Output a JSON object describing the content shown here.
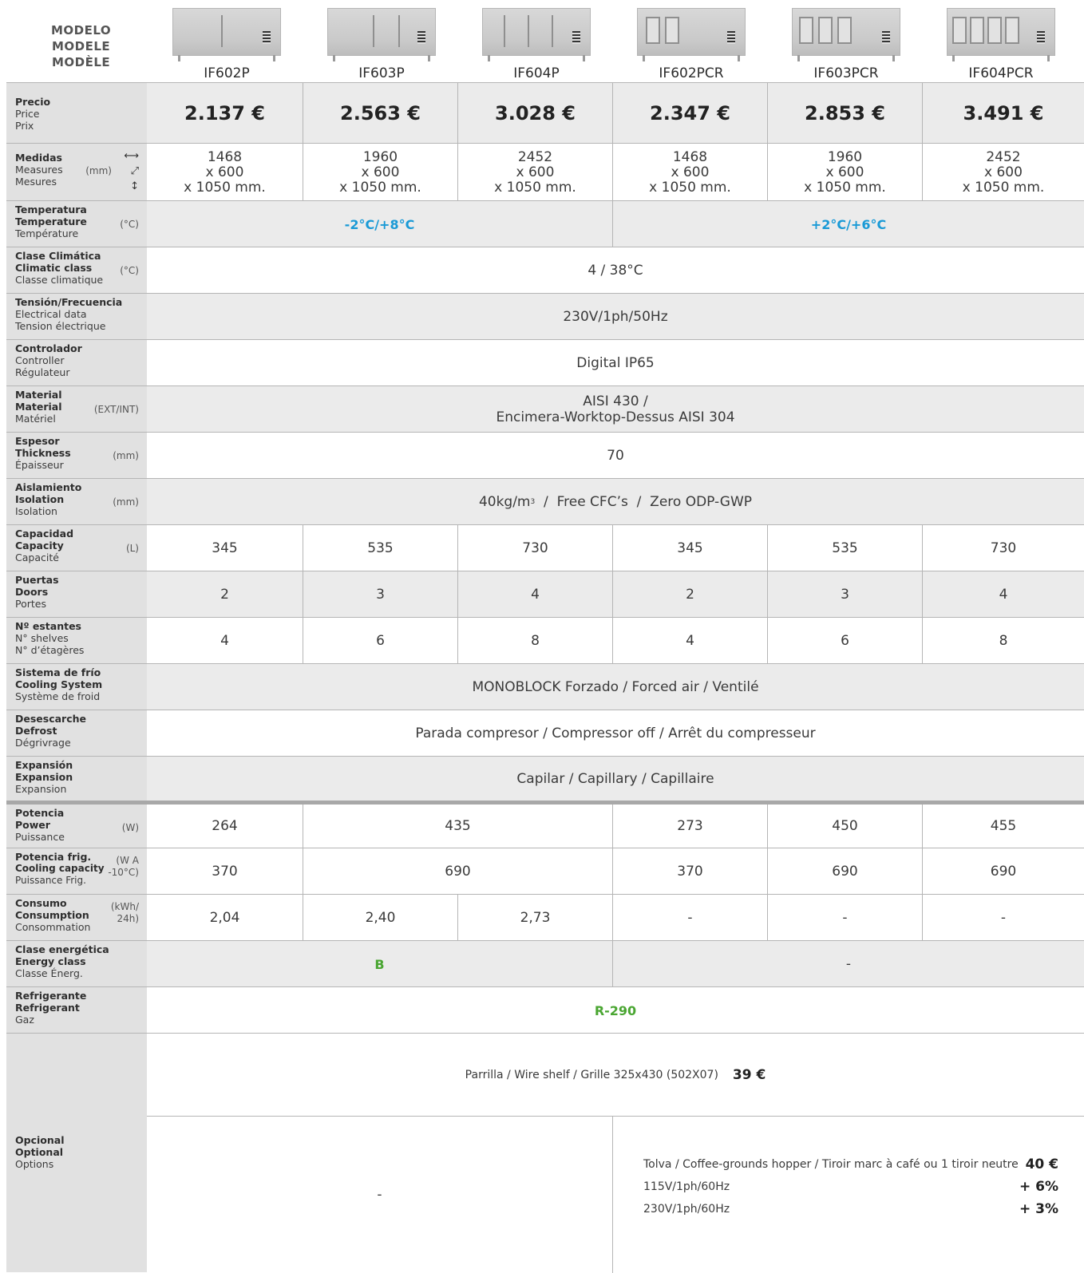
{
  "header": {
    "model_label": [
      "MODELO",
      "MODELE",
      "MODÈLE"
    ],
    "products": [
      "IF602P",
      "IF603P",
      "IF604P",
      "IF602PCR",
      "IF603PCR",
      "IF604PCR"
    ]
  },
  "rows": {
    "price": {
      "label": [
        "Precio",
        "Price",
        "Prix"
      ],
      "unit": "",
      "values": [
        "2.137 €",
        "2.563 €",
        "3.028 €",
        "2.347 €",
        "2.853 €",
        "3.491 €"
      ]
    },
    "measures": {
      "label": [
        "Medidas",
        "Measures",
        "Mesures"
      ],
      "unit": "(mm)",
      "values": [
        [
          "1468",
          "x 600",
          "x 1050 mm."
        ],
        [
          "1960",
          "x 600",
          "x 1050 mm."
        ],
        [
          "2452",
          "x 600",
          "x 1050 mm."
        ],
        [
          "1468",
          "x 600",
          "x 1050 mm."
        ],
        [
          "1960",
          "x 600",
          "x 1050 mm."
        ],
        [
          "2452",
          "x 600",
          "x 1050 mm."
        ]
      ]
    },
    "temperature": {
      "label": [
        "Temperatura",
        "Temperature",
        "Température"
      ],
      "unit": "(°C)",
      "values": [
        "-2°C/+8°C",
        "+2°C/+6°C"
      ],
      "color": "#1a9ad6"
    },
    "climatic": {
      "label": [
        "Clase Climática",
        "Climatic class",
        "Classe climatique"
      ],
      "unit": "(°C)",
      "value": "4 / 38°C"
    },
    "electrical": {
      "label": [
        "Tensión/Frecuencia",
        "Electrical data",
        "Tension électrique"
      ],
      "unit": "",
      "value": "230V/1ph/50Hz"
    },
    "controller": {
      "label": [
        "Controlador",
        "Controller",
        "Régulateur"
      ],
      "unit": "",
      "value": "Digital IP65"
    },
    "material": {
      "label": [
        "Material",
        "Material",
        "Matériel"
      ],
      "unit": "(EXT/INT)",
      "value": [
        "AISI 430 /",
        "Encimera-Worktop-Dessus AISI 304"
      ]
    },
    "thickness": {
      "label": [
        "Espesor",
        "Thickness",
        "Épaisseur"
      ],
      "unit": "(mm)",
      "value": "70"
    },
    "isolation": {
      "label": [
        "Aislamiento",
        "Isolation",
        "Isolation"
      ],
      "unit": "(mm)",
      "value_main": "40kg/m",
      "value_sup": "3",
      "value_rest": "  /  Free CFC’s  /  Zero ODP-GWP"
    },
    "capacity": {
      "label": [
        "Capacidad",
        "Capacity",
        "Capacité"
      ],
      "unit": "(L)",
      "values": [
        "345",
        "535",
        "730",
        "345",
        "535",
        "730"
      ]
    },
    "doors": {
      "label": [
        "Puertas",
        "Doors",
        "Portes"
      ],
      "unit": "",
      "values": [
        "2",
        "3",
        "4",
        "2",
        "3",
        "4"
      ]
    },
    "shelves": {
      "label": [
        "Nº estantes",
        "N° shelves",
        "N° d’étagères"
      ],
      "unit": "",
      "values": [
        "4",
        "6",
        "8",
        "4",
        "6",
        "8"
      ]
    },
    "cooling_system": {
      "label": [
        "Sistema de frío",
        "Cooling System",
        "Système de froid"
      ],
      "unit": "",
      "value": "MONOBLOCK Forzado / Forced air / Ventilé"
    },
    "defrost": {
      "label": [
        "Desescarche",
        "Defrost",
        "Dégrivrage"
      ],
      "unit": "",
      "value": "Parada compresor / Compressor off / Arrêt du compresseur"
    },
    "expansion": {
      "label": [
        "Expansión",
        "Expansion",
        "Expansion"
      ],
      "unit": "",
      "value": "Capilar / Capillary / Capillaire"
    },
    "power": {
      "label": [
        "Potencia",
        "Power",
        "Puissance"
      ],
      "unit": "(W)",
      "values": [
        "264",
        "435",
        "273",
        "450",
        "455"
      ]
    },
    "cooling_capacity": {
      "label": [
        "Potencia frig.",
        "Cooling capacity",
        "Puissance Frig."
      ],
      "unit": [
        "(W A",
        "-10°C)"
      ],
      "values": [
        "370",
        "690",
        "370",
        "690",
        "690"
      ]
    },
    "consumption": {
      "label": [
        "Consumo",
        "Consumption",
        "Consommation"
      ],
      "unit": [
        "(kWh/",
        "24h)"
      ],
      "values": [
        "2,04",
        "2,40",
        "2,73",
        "-",
        "-",
        "-"
      ]
    },
    "energy_class": {
      "label": [
        "Clase energética",
        "Energy class",
        "Classe Énerg."
      ],
      "unit": "",
      "values": [
        "B",
        "-"
      ],
      "color": "#4aa632"
    },
    "refrigerant": {
      "label": [
        "Refrigerante",
        "Refrigerant",
        "Gaz"
      ],
      "unit": "",
      "value": "R-290",
      "color": "#4aa632"
    },
    "optional": {
      "label": [
        "Opcional",
        "Optional",
        "Options"
      ],
      "wire_shelf": "Parrilla / Wire shelf / Grille 325x430 (502X07)",
      "wire_shelf_price": "39 €",
      "left_value": "-",
      "items": [
        {
          "text": "Tolva / Coffee-grounds hopper / Tiroir marc à café ou 1 tiroir neutre",
          "price": "40 €"
        },
        {
          "text": "115V/1ph/60Hz",
          "price": "+ 6%"
        },
        {
          "text": "230V/1ph/60Hz",
          "price": "+ 3%"
        }
      ]
    }
  }
}
